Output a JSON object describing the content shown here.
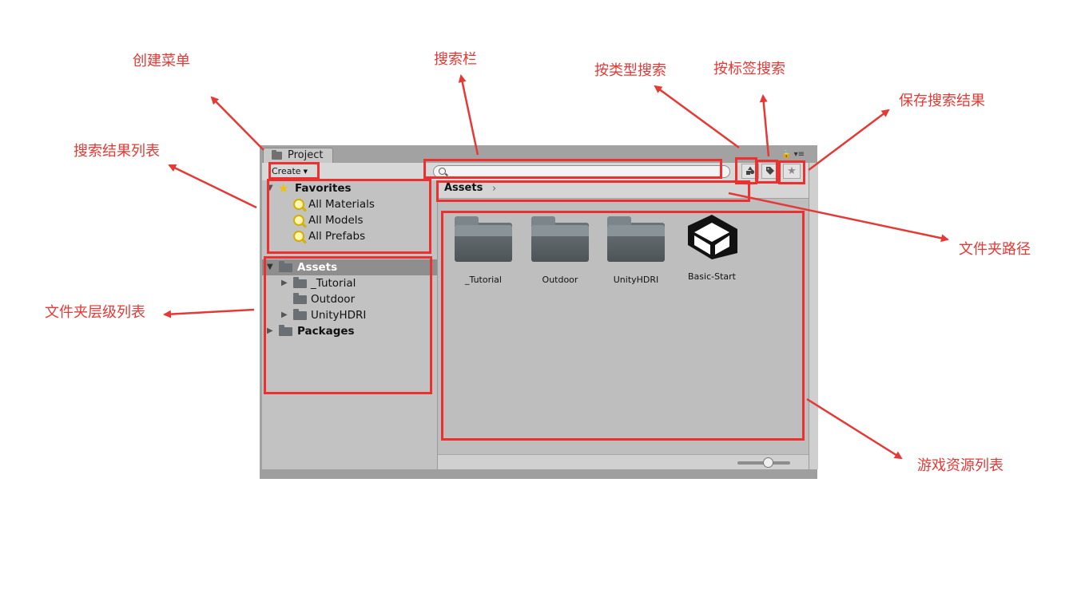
{
  "window": {
    "tab_title": "Project",
    "controls": "🔒 ▾≡"
  },
  "toolbar": {
    "create_label": "Create",
    "create_caret": "▼",
    "search_placeholder": "",
    "type_filter_icon": "shapes-icon",
    "label_filter_icon": "tag-icon",
    "save_search_icon": "star-icon"
  },
  "favorites": {
    "header": "Favorites",
    "items": [
      "All Materials",
      "All Models",
      "All Prefabs"
    ]
  },
  "tree": {
    "root": "Assets",
    "children": [
      "_Tutorial",
      "Outdoor",
      "UnityHDRI"
    ],
    "packages": "Packages"
  },
  "breadcrumb": {
    "label": "Assets",
    "chevron": "›"
  },
  "assets": [
    {
      "name": "_Tutorial",
      "icon": "folder-icon"
    },
    {
      "name": "Outdoor",
      "icon": "folder-icon"
    },
    {
      "name": "UnityHDRI",
      "icon": "folder-icon"
    },
    {
      "name": "Basic-Start",
      "icon": "unity-logo-icon"
    }
  ],
  "annotations": {
    "create_menu": "创建菜单",
    "search_bar": "搜索栏",
    "search_by_type": "按类型搜索",
    "search_by_label": "按标签搜索",
    "save_search": "保存搜索结果",
    "search_results_list": "搜索结果列表",
    "folder_path": "文件夹路径",
    "folder_hierarchy": "文件夹层级列表",
    "asset_list": "游戏资源列表"
  },
  "colors": {
    "annotation_red": "#e53935",
    "window_bg": "#c2c2c2",
    "selection": "#8e8e8e"
  }
}
